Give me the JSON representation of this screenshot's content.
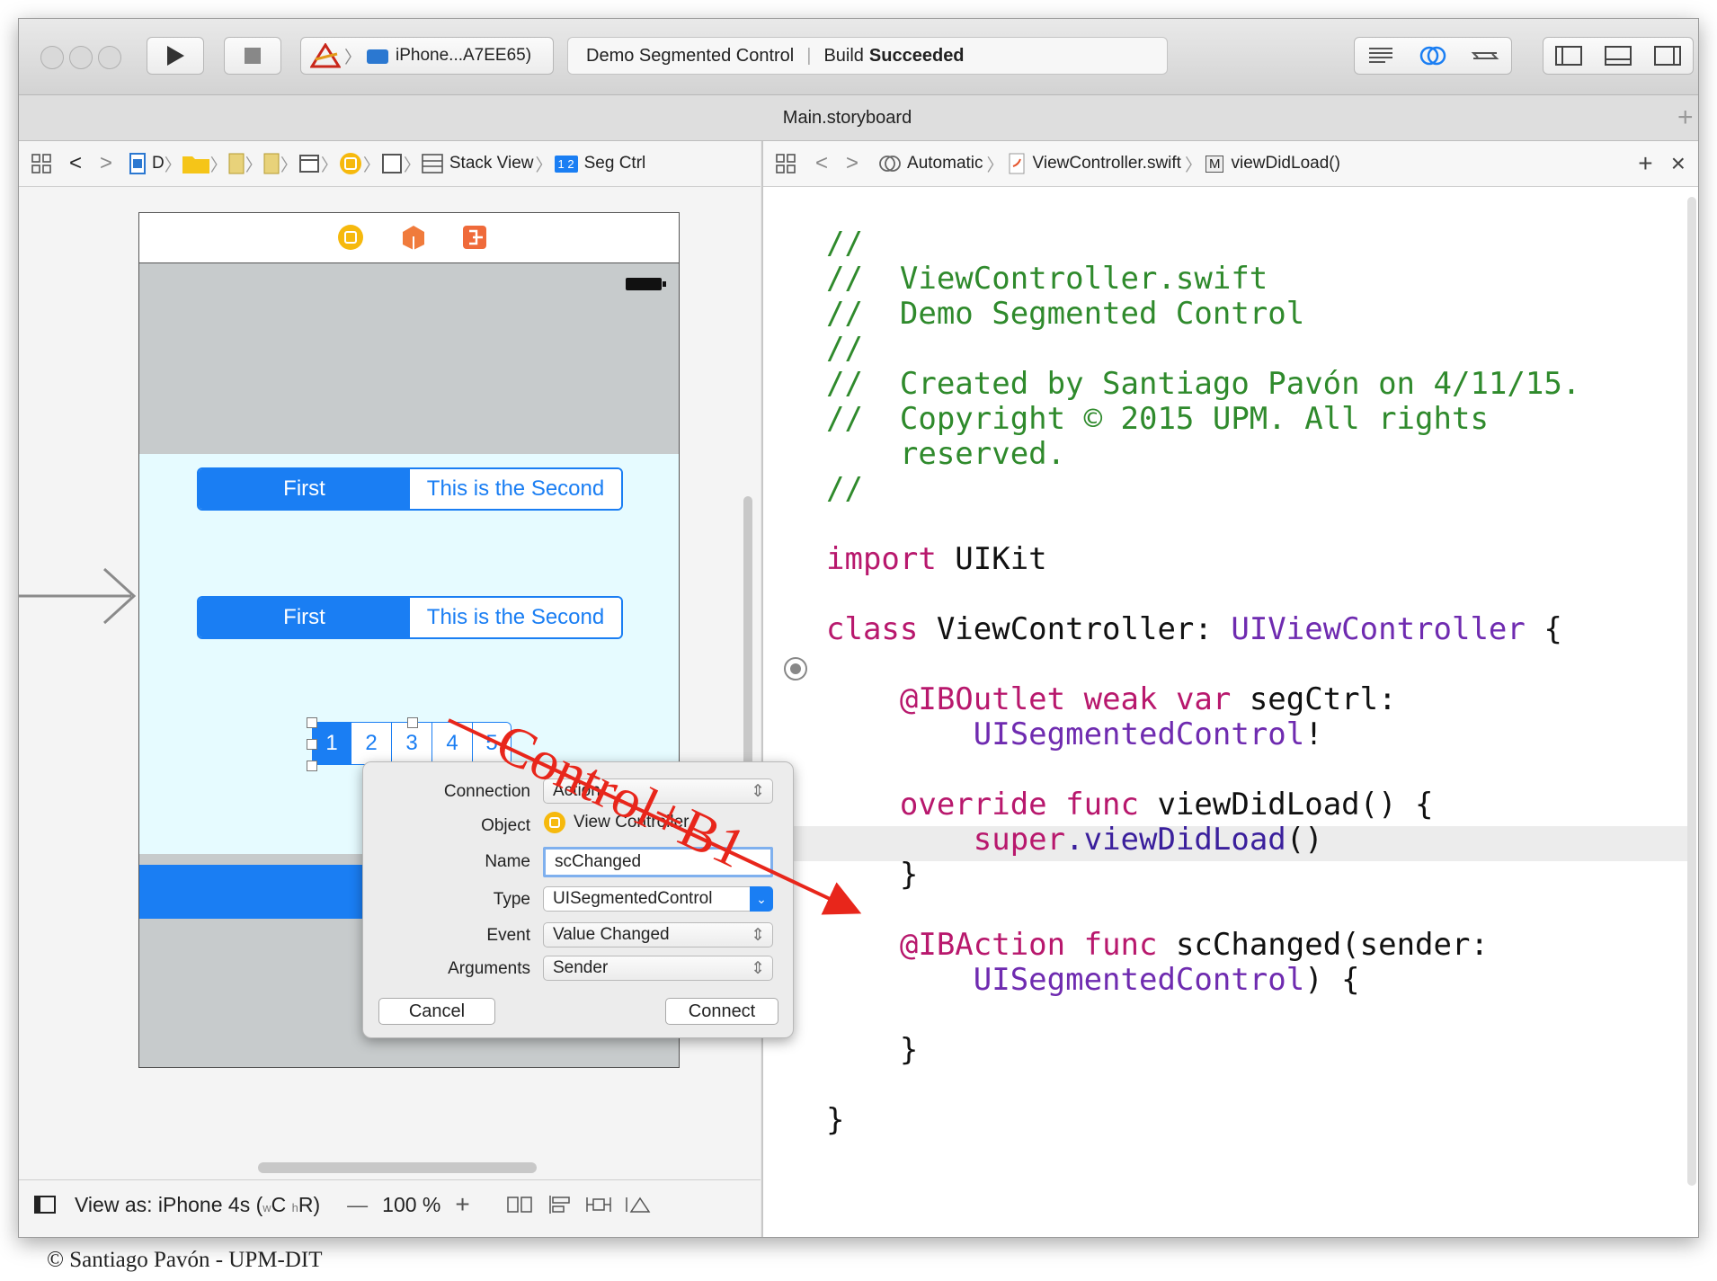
{
  "toolbar": {
    "scheme_device": "iPhone...A7EE65)",
    "activity_project": "Demo Segmented Control",
    "activity_status_prefix": "Build",
    "activity_status": "Succeeded"
  },
  "tab": {
    "title": "Main.storyboard",
    "add": "+"
  },
  "left_jumpbar": {
    "item_d": "D",
    "stack_view": "Stack View",
    "seg_badge": "1 2",
    "seg_ctrl": "Seg Ctrl"
  },
  "right_jumpbar": {
    "automatic": "Automatic",
    "file": "ViewController.swift",
    "method_badge": "M",
    "method": "viewDidLoad()",
    "plus": "+",
    "close": "×"
  },
  "canvas": {
    "segmented_1": [
      "First",
      "This is the Second"
    ],
    "segmented_2": [
      "First",
      "This is the Second"
    ],
    "numbered_segments": [
      "1",
      "2",
      "3",
      "4",
      "5"
    ]
  },
  "popup": {
    "connection_label": "Connection",
    "connection_value": "Action",
    "object_label": "Object",
    "object_value": "View Controller",
    "name_label": "Name",
    "name_value": "scChanged",
    "type_label": "Type",
    "type_value": "UISegmentedControl",
    "event_label": "Event",
    "event_value": "Value Changed",
    "arguments_label": "Arguments",
    "arguments_value": "Sender",
    "cancel": "Cancel",
    "connect": "Connect"
  },
  "annotation": {
    "label": "Control+B1",
    "color": "#e8261b"
  },
  "status": {
    "view_as": "View as: iPhone 4s (",
    "w": "w",
    "c": "C ",
    "h": "h",
    "r": "R)",
    "minus": "—",
    "zoom": "100 %",
    "plus": "+"
  },
  "code": {
    "l1": "//",
    "l2": "//  ViewController.swift",
    "l3": "//  Demo Segmented Control",
    "l4": "//",
    "l5": "//  Created by Santiago Pavón on 4/11/15.",
    "l6": "//  Copyright © 2015 UPM. All rights",
    "l7": "    reserved.",
    "l8": "//",
    "import_kw": "import",
    "import_mod": " UIKit",
    "class_kw": "class",
    "class_name": " ViewController: ",
    "superclass": "UIViewController",
    "brace_open": " {",
    "outlet_attr": "@IBOutlet",
    "outlet_kw": " weak var",
    "outlet_name": " segCtrl:",
    "outlet_type": "UISegmentedControl",
    "bang": "!",
    "override_kw": "override func",
    "vdl": " viewDidLoad() {",
    "super_kw": "super",
    "super_call": ".viewDidLoad",
    "parens": "()",
    "close_brace": "}",
    "action_attr": "@IBAction",
    "action_kw": " func",
    "action_sig": " scChanged(sender:",
    "action_type": "UISegmentedControl",
    "action_end": ") {",
    "close_brace2": "}",
    "close_brace3": "}"
  },
  "footer": "© Santiago Pavón - UPM-DIT",
  "colors": {
    "accent": "#1a7ef3",
    "comment": "#2f8a2c",
    "keyword": "#b8186d",
    "type": "#6f2bb0"
  }
}
